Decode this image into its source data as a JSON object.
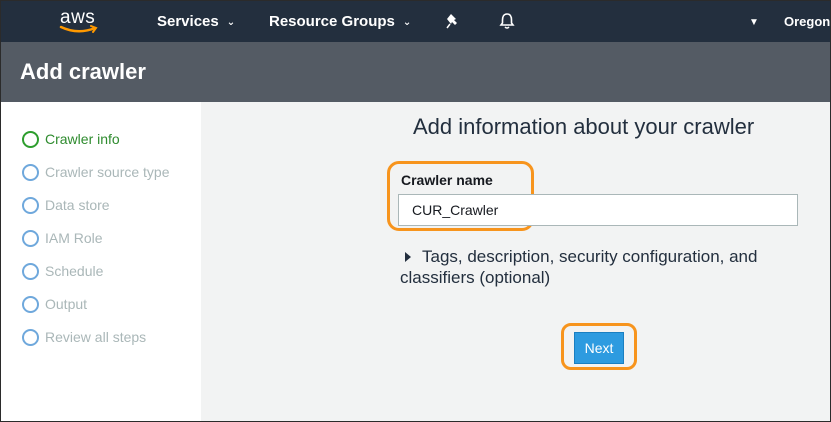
{
  "topnav": {
    "logo_text": "aws",
    "services_label": "Services",
    "resource_groups_label": "Resource Groups",
    "pin_icon": "pin-icon",
    "bell_icon": "bell-icon",
    "region_label": "Oregon"
  },
  "page": {
    "title": "Add crawler"
  },
  "sidebar": {
    "steps": [
      {
        "label": "Crawler info",
        "active": true
      },
      {
        "label": "Crawler source type",
        "active": false
      },
      {
        "label": "Data store",
        "active": false
      },
      {
        "label": "IAM Role",
        "active": false
      },
      {
        "label": "Schedule",
        "active": false
      },
      {
        "label": "Output",
        "active": false
      },
      {
        "label": "Review all steps",
        "active": false
      }
    ]
  },
  "main": {
    "heading": "Add information about your crawler",
    "crawler_name_label": "Crawler name",
    "crawler_name_value": "CUR_Crawler",
    "expander_label": "Tags, description, security configuration, and classifiers (optional)",
    "next_label": "Next"
  },
  "colors": {
    "nav_bg": "#232f3e",
    "titlebar_bg": "#545b64",
    "highlight": "#f7941d",
    "active_step": "#2e9e2e",
    "primary_button": "#2d9be0"
  }
}
